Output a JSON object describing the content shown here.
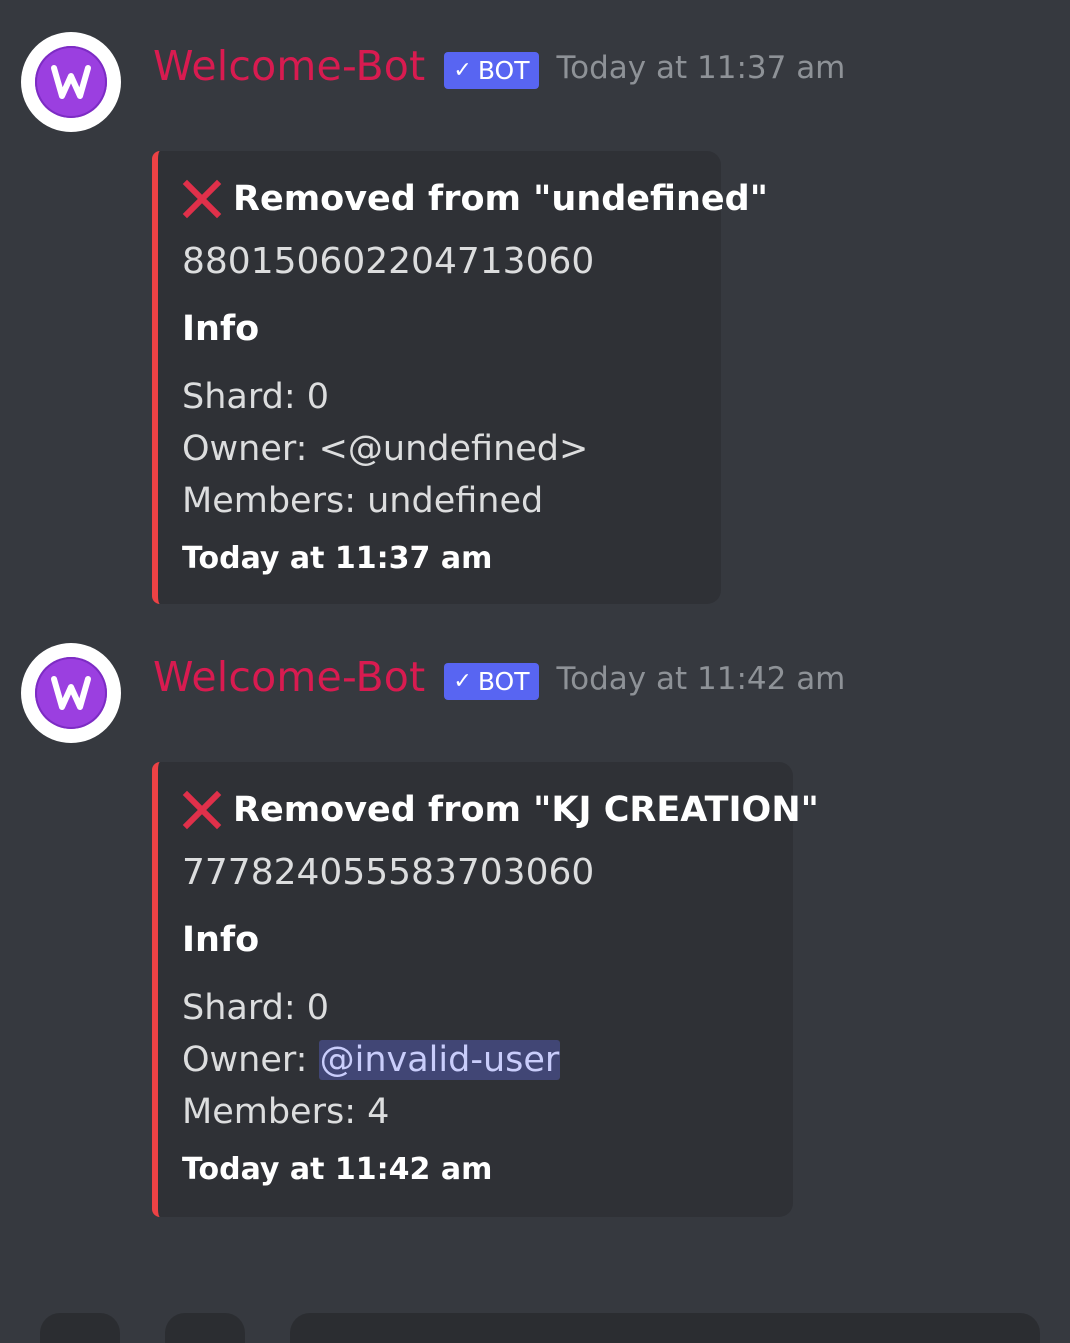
{
  "messages": [
    {
      "username": "Welcome-Bot",
      "bot_tag": "BOT",
      "timestamp": "Today at 11:37 am",
      "embed": {
        "title": "Removed from \"undefined\"",
        "description": "880150602204713060",
        "field_name": "Info",
        "lines": {
          "shard": "Shard: 0",
          "owner_prefix": "Owner: ",
          "owner_value": "<@undefined>",
          "members": "Members: undefined"
        },
        "footer": "Today at 11:37 am",
        "accent_color": "#ed4245"
      }
    },
    {
      "username": "Welcome-Bot",
      "bot_tag": "BOT",
      "timestamp": "Today at 11:42 am",
      "embed": {
        "title": "Removed from \"KJ CREATION\"",
        "description": "777824055583703060",
        "field_name": "Info",
        "lines": {
          "shard": "Shard: 0",
          "owner_prefix": "Owner: ",
          "owner_value": "@invalid-user",
          "members": "Members: 4"
        },
        "footer": "Today at 11:42 am",
        "accent_color": "#ed4245"
      }
    }
  ],
  "icons": {
    "avatar": "letter-w-avatar-icon",
    "verified": "checkmark-icon",
    "removed": "red-x-icon"
  },
  "colors": {
    "background": "#36393f",
    "embed_background": "#2f3136",
    "username": "#d81b50",
    "bot_tag": "#5865f2",
    "mention_background": "#414675"
  }
}
